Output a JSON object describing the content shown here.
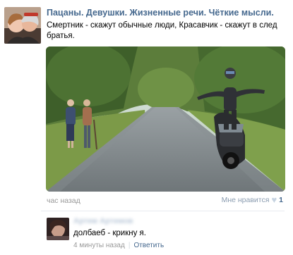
{
  "post": {
    "author": "Пацаны. Девушки. Жизненные речи. Чёткие мысли.",
    "text": "Смертник - скажут обычные люди, Красавчик - скажут в след братья.",
    "time_ago": "час назад",
    "like_label": "Мне нравится",
    "like_count": "1",
    "photo_icon": "photo-image",
    "avatar_icon": "community-avatar"
  },
  "comment": {
    "author": "Артем Артемов",
    "text": "долбаеб - крикну я.",
    "time_ago": "4 минуты назад",
    "separator": "|",
    "reply_label": "Ответить"
  },
  "colors": {
    "link": "#45688e",
    "muted": "#999999",
    "heart": "#c6d3e1"
  }
}
